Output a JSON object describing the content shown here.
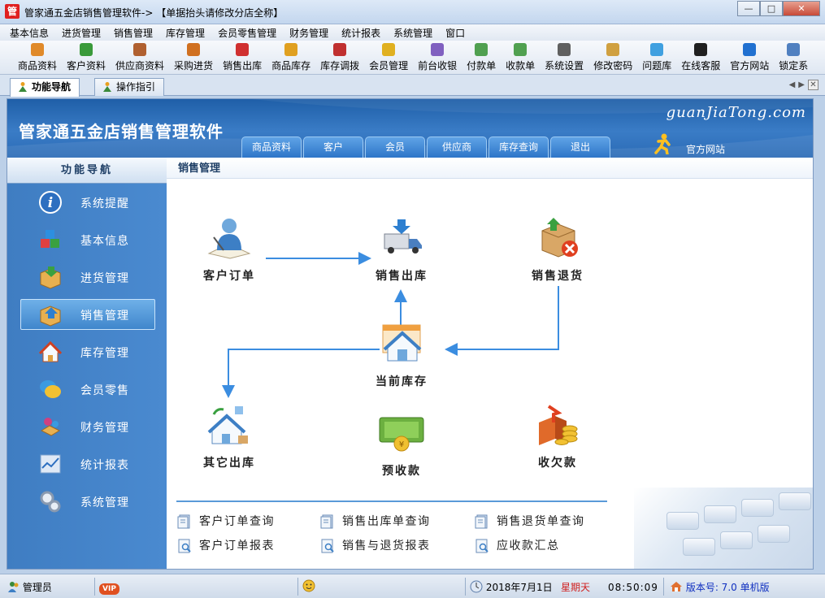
{
  "window": {
    "title": "管家通五金店销售管理软件-> 【单据抬头请修改分店全称】",
    "app_icon": "管"
  },
  "menu": [
    "基本信息",
    "进货管理",
    "销售管理",
    "库存管理",
    "会员零售管理",
    "财务管理",
    "统计报表",
    "系统管理",
    "窗口"
  ],
  "toolbar": [
    {
      "label": "商品资料",
      "icon": "goods-icon",
      "color": "#e08a2a"
    },
    {
      "label": "客户资料",
      "icon": "customers-icon",
      "color": "#3a9a3a"
    },
    {
      "label": "供应商资料",
      "icon": "suppliers-icon",
      "color": "#b06030"
    },
    {
      "label": "采购进货",
      "icon": "purchase-icon",
      "color": "#d07020"
    },
    {
      "label": "销售出库",
      "icon": "sales-out-icon",
      "color": "#d03030"
    },
    {
      "label": "商品库存",
      "icon": "stock-icon",
      "color": "#e0a020"
    },
    {
      "label": "库存调拨",
      "icon": "transfer-icon",
      "color": "#c03030"
    },
    {
      "label": "会员管理",
      "icon": "member-icon",
      "color": "#e0b020"
    },
    {
      "label": "前台收银",
      "icon": "cashier-icon",
      "color": "#8060c0"
    },
    {
      "label": "付款单",
      "icon": "payment-icon",
      "color": "#50a050"
    },
    {
      "label": "收款单",
      "icon": "receipt-icon",
      "color": "#50a050"
    },
    {
      "label": "系统设置",
      "icon": "settings-icon",
      "color": "#606060"
    },
    {
      "label": "修改密码",
      "icon": "password-icon",
      "color": "#d0a040"
    },
    {
      "label": "问题库",
      "icon": "faq-icon",
      "color": "#40a0e0"
    },
    {
      "label": "在线客服",
      "icon": "qq-icon",
      "color": "#202020"
    },
    {
      "label": "官方网站",
      "icon": "ie-icon",
      "color": "#2070d0"
    },
    {
      "label": "锁定系",
      "icon": "lock-icon",
      "color": "#5080c0"
    }
  ],
  "tabs": [
    {
      "label": "功能导航",
      "active": true
    },
    {
      "label": "操作指引",
      "active": false
    }
  ],
  "banner": {
    "title": "管家通五金店销售管理软件",
    "url": "guanJiaTong.com",
    "tabs": [
      "商品资料",
      "客户",
      "会员",
      "供应商",
      "库存查询",
      "退出"
    ],
    "official_label": "官方网站"
  },
  "sidebar": {
    "header": "功能导航",
    "items": [
      {
        "label": "系统提醒",
        "icon": "info-icon"
      },
      {
        "label": "基本信息",
        "icon": "cubes-icon"
      },
      {
        "label": "进货管理",
        "icon": "box-in-icon"
      },
      {
        "label": "销售管理",
        "icon": "box-out-icon",
        "active": true
      },
      {
        "label": "库存管理",
        "icon": "house-icon"
      },
      {
        "label": "会员零售",
        "icon": "chat-icon"
      },
      {
        "label": "财务管理",
        "icon": "finance-icon"
      },
      {
        "label": "统计报表",
        "icon": "chart-icon"
      },
      {
        "label": "系统管理",
        "icon": "gears-icon"
      }
    ]
  },
  "content": {
    "header": "销售管理",
    "nodes": {
      "customer_order": "客户订单",
      "sales_out": "销售出库",
      "sales_return": "销售退货",
      "current_stock": "当前库存",
      "other_out": "其它出库",
      "prepayment": "预收款",
      "receivable": "收欠款"
    },
    "links": [
      "客户订单查询",
      "销售出库单查询",
      "销售退货单查询",
      "客户订单报表",
      "销售与退货报表",
      "应收款汇总"
    ]
  },
  "statusbar": {
    "user": "管理员",
    "vip": "VIP",
    "date": "2018年7月1日",
    "weekday": "星期天",
    "time": "08:50:09",
    "version": "版本号: 7.0 单机版"
  },
  "colors": {
    "banner": "#2b6bb6",
    "sidebar": "#4a8ad0",
    "arrow": "#3b8de0",
    "weekday": "#d02020",
    "version": "#1030c0"
  }
}
